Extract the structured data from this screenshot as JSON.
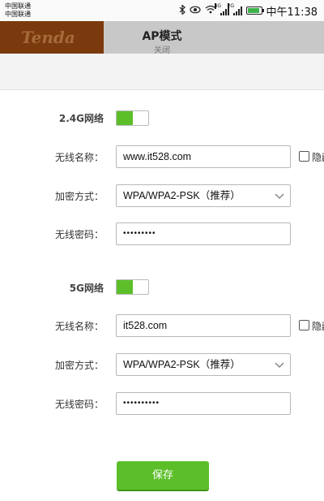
{
  "status_bar": {
    "carrier_1": "中国联通",
    "carrier_2": "中国联通",
    "signal_1_tag": "4G",
    "signal_2_tag": "2G",
    "time": "中午11:38"
  },
  "header": {
    "logo_text": "Tenda",
    "title": "AP模式",
    "subtitle": "关闭"
  },
  "wifi_24g": {
    "section_label": "2.4G网络",
    "enabled": true,
    "name_label": "无线名称：",
    "name_value": "www.it528.com",
    "hide_label": "隐藏",
    "encryption_label": "加密方式：",
    "encryption_value": "WPA/WPA2-PSK（推荐）",
    "password_label": "无线密码：",
    "password_value": "•••••••••"
  },
  "wifi_5g": {
    "section_label": "5G网络",
    "enabled": true,
    "name_label": "无线名称：",
    "name_value": "it528.com",
    "hide_label": "隐藏",
    "encryption_label": "加密方式：",
    "encryption_value": "WPA/WPA2-PSK（推荐）",
    "password_label": "无线密码：",
    "password_value": "••••••••••"
  },
  "save_label": "保存",
  "colors": {
    "accent_green": "#5cbf2a",
    "logo_brown": "#7b3a0d",
    "header_gray": "#c8c8c8"
  }
}
